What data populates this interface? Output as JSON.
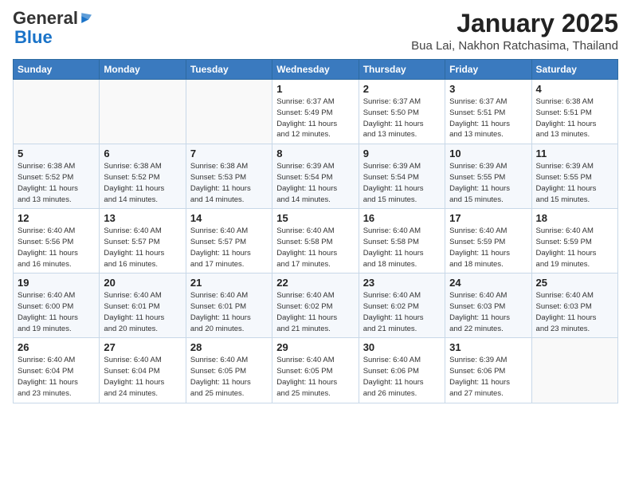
{
  "logo": {
    "general": "General",
    "blue": "Blue"
  },
  "title": "January 2025",
  "location": "Bua Lai, Nakhon Ratchasima, Thailand",
  "days_of_week": [
    "Sunday",
    "Monday",
    "Tuesday",
    "Wednesday",
    "Thursday",
    "Friday",
    "Saturday"
  ],
  "weeks": [
    [
      {
        "day": "",
        "info": ""
      },
      {
        "day": "",
        "info": ""
      },
      {
        "day": "",
        "info": ""
      },
      {
        "day": "1",
        "info": "Sunrise: 6:37 AM\nSunset: 5:49 PM\nDaylight: 11 hours\nand 12 minutes."
      },
      {
        "day": "2",
        "info": "Sunrise: 6:37 AM\nSunset: 5:50 PM\nDaylight: 11 hours\nand 13 minutes."
      },
      {
        "day": "3",
        "info": "Sunrise: 6:37 AM\nSunset: 5:51 PM\nDaylight: 11 hours\nand 13 minutes."
      },
      {
        "day": "4",
        "info": "Sunrise: 6:38 AM\nSunset: 5:51 PM\nDaylight: 11 hours\nand 13 minutes."
      }
    ],
    [
      {
        "day": "5",
        "info": "Sunrise: 6:38 AM\nSunset: 5:52 PM\nDaylight: 11 hours\nand 13 minutes."
      },
      {
        "day": "6",
        "info": "Sunrise: 6:38 AM\nSunset: 5:52 PM\nDaylight: 11 hours\nand 14 minutes."
      },
      {
        "day": "7",
        "info": "Sunrise: 6:38 AM\nSunset: 5:53 PM\nDaylight: 11 hours\nand 14 minutes."
      },
      {
        "day": "8",
        "info": "Sunrise: 6:39 AM\nSunset: 5:54 PM\nDaylight: 11 hours\nand 14 minutes."
      },
      {
        "day": "9",
        "info": "Sunrise: 6:39 AM\nSunset: 5:54 PM\nDaylight: 11 hours\nand 15 minutes."
      },
      {
        "day": "10",
        "info": "Sunrise: 6:39 AM\nSunset: 5:55 PM\nDaylight: 11 hours\nand 15 minutes."
      },
      {
        "day": "11",
        "info": "Sunrise: 6:39 AM\nSunset: 5:55 PM\nDaylight: 11 hours\nand 15 minutes."
      }
    ],
    [
      {
        "day": "12",
        "info": "Sunrise: 6:40 AM\nSunset: 5:56 PM\nDaylight: 11 hours\nand 16 minutes."
      },
      {
        "day": "13",
        "info": "Sunrise: 6:40 AM\nSunset: 5:57 PM\nDaylight: 11 hours\nand 16 minutes."
      },
      {
        "day": "14",
        "info": "Sunrise: 6:40 AM\nSunset: 5:57 PM\nDaylight: 11 hours\nand 17 minutes."
      },
      {
        "day": "15",
        "info": "Sunrise: 6:40 AM\nSunset: 5:58 PM\nDaylight: 11 hours\nand 17 minutes."
      },
      {
        "day": "16",
        "info": "Sunrise: 6:40 AM\nSunset: 5:58 PM\nDaylight: 11 hours\nand 18 minutes."
      },
      {
        "day": "17",
        "info": "Sunrise: 6:40 AM\nSunset: 5:59 PM\nDaylight: 11 hours\nand 18 minutes."
      },
      {
        "day": "18",
        "info": "Sunrise: 6:40 AM\nSunset: 5:59 PM\nDaylight: 11 hours\nand 19 minutes."
      }
    ],
    [
      {
        "day": "19",
        "info": "Sunrise: 6:40 AM\nSunset: 6:00 PM\nDaylight: 11 hours\nand 19 minutes."
      },
      {
        "day": "20",
        "info": "Sunrise: 6:40 AM\nSunset: 6:01 PM\nDaylight: 11 hours\nand 20 minutes."
      },
      {
        "day": "21",
        "info": "Sunrise: 6:40 AM\nSunset: 6:01 PM\nDaylight: 11 hours\nand 20 minutes."
      },
      {
        "day": "22",
        "info": "Sunrise: 6:40 AM\nSunset: 6:02 PM\nDaylight: 11 hours\nand 21 minutes."
      },
      {
        "day": "23",
        "info": "Sunrise: 6:40 AM\nSunset: 6:02 PM\nDaylight: 11 hours\nand 21 minutes."
      },
      {
        "day": "24",
        "info": "Sunrise: 6:40 AM\nSunset: 6:03 PM\nDaylight: 11 hours\nand 22 minutes."
      },
      {
        "day": "25",
        "info": "Sunrise: 6:40 AM\nSunset: 6:03 PM\nDaylight: 11 hours\nand 23 minutes."
      }
    ],
    [
      {
        "day": "26",
        "info": "Sunrise: 6:40 AM\nSunset: 6:04 PM\nDaylight: 11 hours\nand 23 minutes."
      },
      {
        "day": "27",
        "info": "Sunrise: 6:40 AM\nSunset: 6:04 PM\nDaylight: 11 hours\nand 24 minutes."
      },
      {
        "day": "28",
        "info": "Sunrise: 6:40 AM\nSunset: 6:05 PM\nDaylight: 11 hours\nand 25 minutes."
      },
      {
        "day": "29",
        "info": "Sunrise: 6:40 AM\nSunset: 6:05 PM\nDaylight: 11 hours\nand 25 minutes."
      },
      {
        "day": "30",
        "info": "Sunrise: 6:40 AM\nSunset: 6:06 PM\nDaylight: 11 hours\nand 26 minutes."
      },
      {
        "day": "31",
        "info": "Sunrise: 6:39 AM\nSunset: 6:06 PM\nDaylight: 11 hours\nand 27 minutes."
      },
      {
        "day": "",
        "info": ""
      }
    ]
  ]
}
